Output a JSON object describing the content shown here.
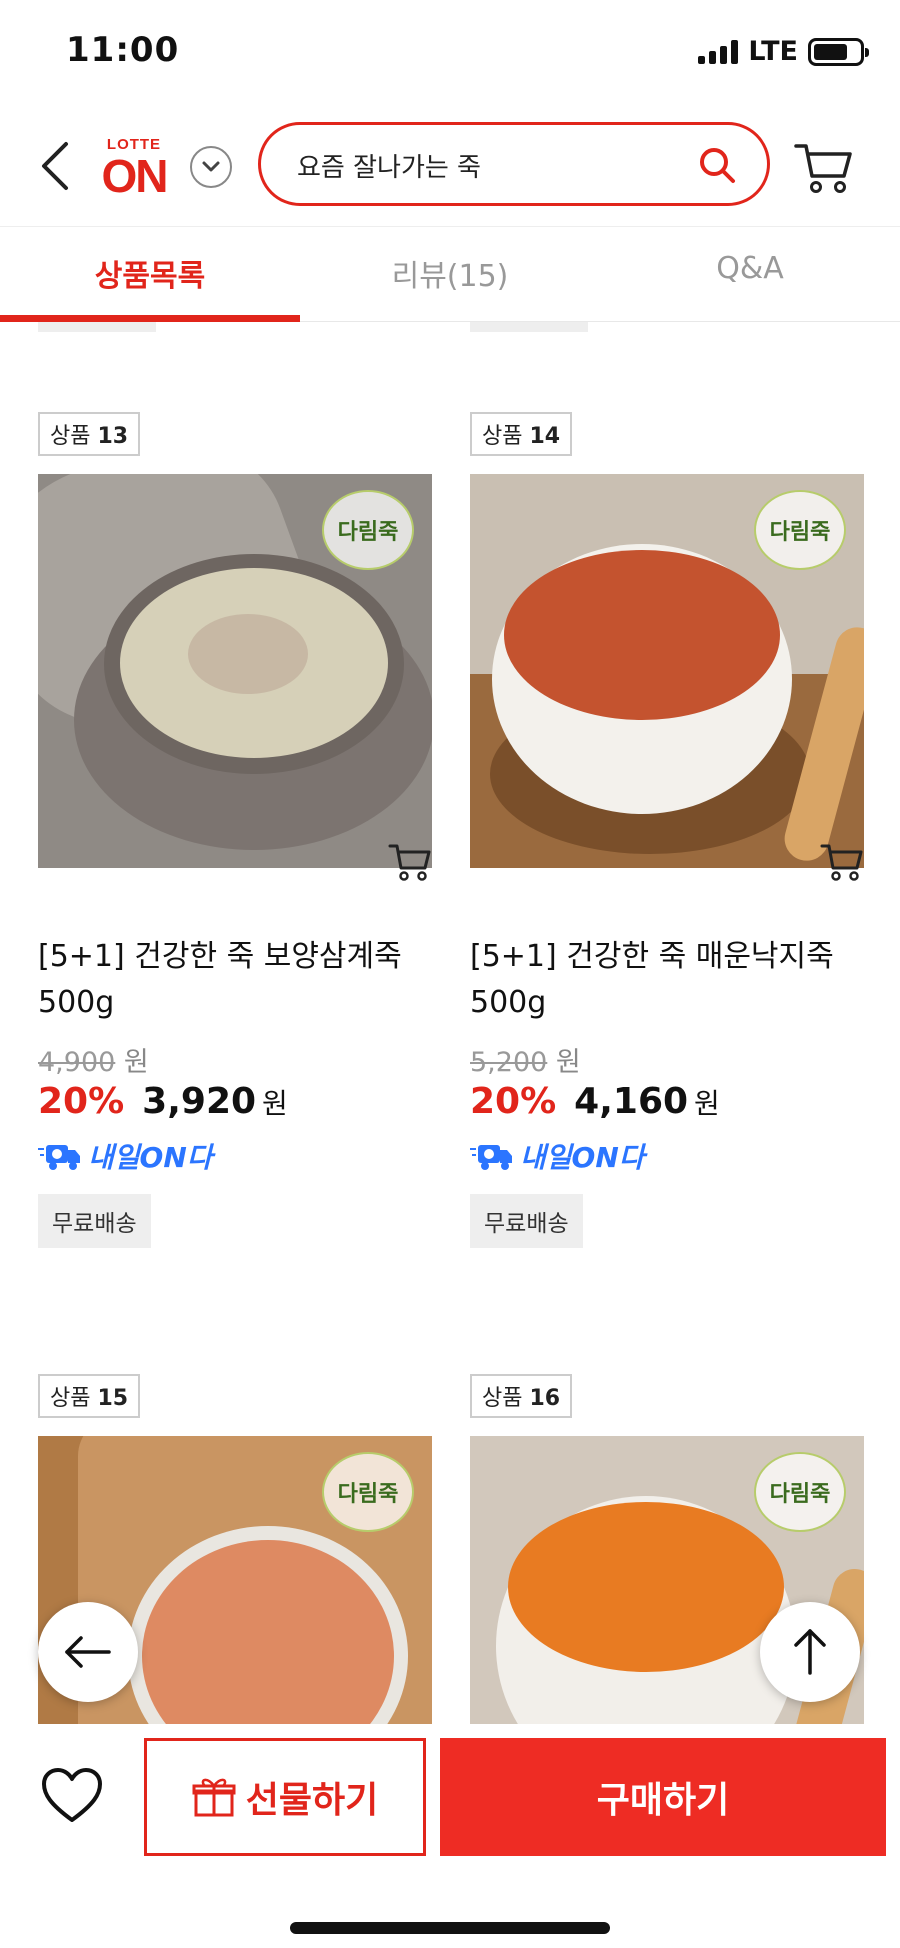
{
  "status": {
    "time": "11:00",
    "network": "LTE"
  },
  "header": {
    "logo_top": "LOTTE",
    "logo_main": "ON",
    "search_value": "요즘 잘나가는 죽"
  },
  "tabs": [
    {
      "label": "상품목록",
      "active": true
    },
    {
      "label": "리뷰(15)",
      "active": false
    },
    {
      "label": "Q&A",
      "active": false
    }
  ],
  "products": [
    {
      "badge_prefix": "상품",
      "badge_num": "13",
      "name_line1": "[5+1] 건강한 죽 보양삼계죽",
      "name_line2": "500g",
      "original_price": "4,900",
      "discount": "20%",
      "price": "3,920",
      "currency": "원",
      "delivery": "내일ON다",
      "shipping": "무료배송"
    },
    {
      "badge_prefix": "상품",
      "badge_num": "14",
      "name_line1": "[5+1] 건강한 죽 매운낙지죽",
      "name_line2": "500g",
      "original_price": "5,200",
      "discount": "20%",
      "price": "4,160",
      "currency": "원",
      "delivery": "내일ON다",
      "shipping": "무료배송"
    },
    {
      "badge_prefix": "상품",
      "badge_num": "15"
    },
    {
      "badge_prefix": "상품",
      "badge_num": "16"
    }
  ],
  "brand_stamp": "다림죽",
  "bottom_bar": {
    "gift_label": "선물하기",
    "buy_label": "구매하기"
  },
  "colors": {
    "accent": "#e1251b",
    "delivery_blue": "#2b75ff"
  }
}
